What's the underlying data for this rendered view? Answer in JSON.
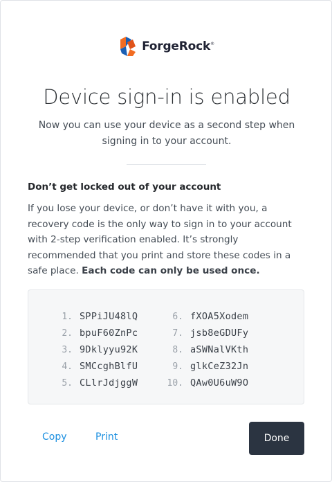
{
  "brand": {
    "name": "ForgeRock",
    "trademark": "®"
  },
  "title": "Device sign-in is enabled",
  "subtitle": "Now you can use your device as a second step when signing in to your account.",
  "warning": {
    "heading": "Don’t get locked out of your account",
    "body": "If you lose your device, or don’t have it with you, a recovery code is the only way to sign in to your account with 2-step verification enabled. It’s strongly recommended that you print and store these codes in a safe place.",
    "emphasis": "Each code can only be used once."
  },
  "codes": [
    {
      "num": "1.",
      "code": "SPPiJU48lQ"
    },
    {
      "num": "2.",
      "code": "bpuF60ZnPc"
    },
    {
      "num": "3.",
      "code": "9Dklyyu92K"
    },
    {
      "num": "4.",
      "code": "SMCcghBlfU"
    },
    {
      "num": "5.",
      "code": "CLlrJdjggW"
    },
    {
      "num": "6.",
      "code": "fXOA5Xodem"
    },
    {
      "num": "7.",
      "code": "jsb8eGDUFy"
    },
    {
      "num": "8.",
      "code": "aSWNalVKth"
    },
    {
      "num": "9.",
      "code": "glkCeZ32Jn"
    },
    {
      "num": "10.",
      "code": "QAw0U6uW9O"
    }
  ],
  "actions": {
    "copy_label": "Copy",
    "print_label": "Print",
    "done_label": "Done"
  },
  "colors": {
    "link": "#1b8fe0",
    "primary_button": "#2b3441",
    "logo_orange": "#f26c22",
    "logo_blue": "#1a5fb4"
  }
}
